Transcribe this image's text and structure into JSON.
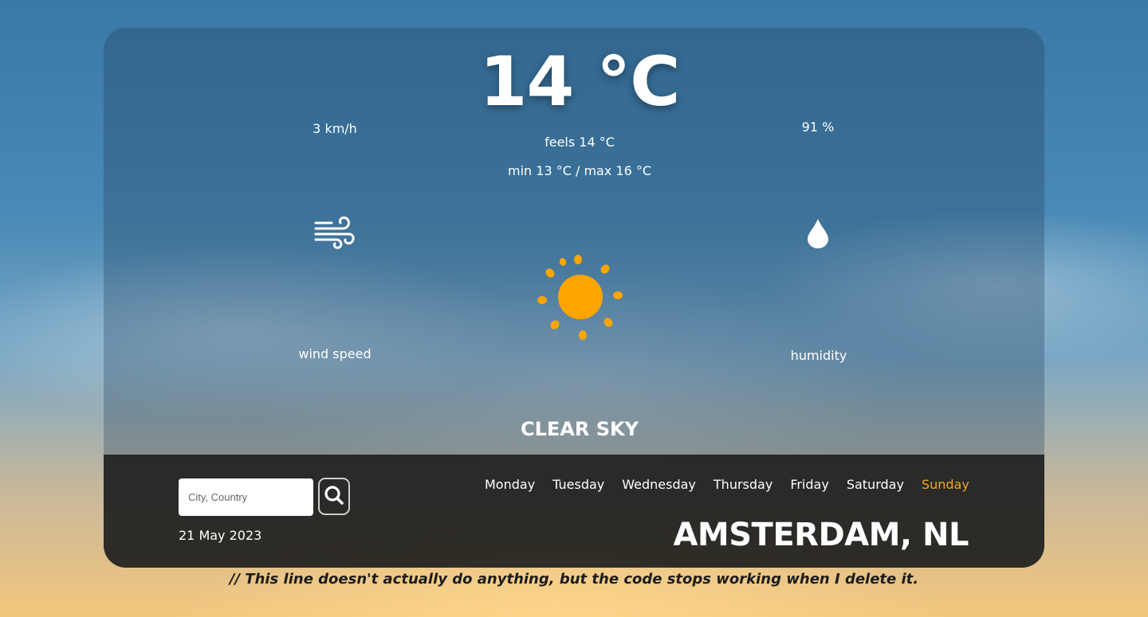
{
  "weather": {
    "temperature": "14 °C",
    "feels_like": "feels 14 °C",
    "min_max": "min 13 °C / max 16 °C",
    "wind_speed_value": "3 km/h",
    "wind_speed_label": "wind speed",
    "humidity_value": "91 %",
    "humidity_label": "humidity",
    "description": "CLEAR SKY",
    "condition_icon": "sun-icon"
  },
  "search": {
    "placeholder": "City, Country",
    "button_icon": "search-icon"
  },
  "date": "21 May 2023",
  "days": [
    {
      "label": "Monday"
    },
    {
      "label": "Tuesday"
    },
    {
      "label": "Wednesday"
    },
    {
      "label": "Thursday"
    },
    {
      "label": "Friday"
    },
    {
      "label": "Saturday"
    },
    {
      "label": "Sunday"
    }
  ],
  "selected_day": "Sunday",
  "location": "AMSTERDAM, NL",
  "footer_note": "// This line doesn't actually do anything, but the code stops working when I delete it.",
  "colors": {
    "accent": "#f5a623",
    "sun": "#ffa500",
    "text": "#ffffff"
  }
}
